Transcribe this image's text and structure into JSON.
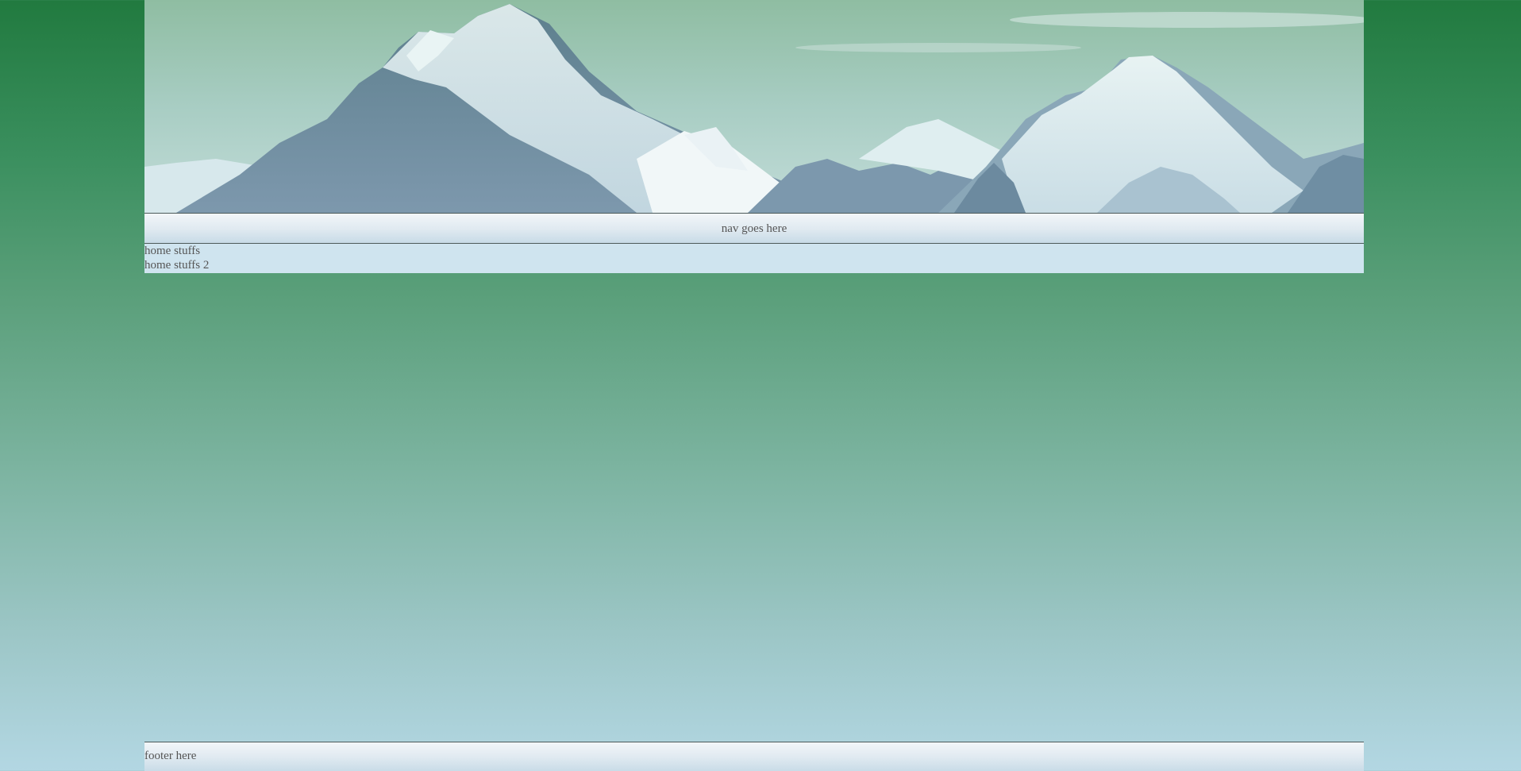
{
  "header": {
    "banner_image": "snowy-mountain-range"
  },
  "nav": {
    "label": "nav goes here"
  },
  "main": {
    "items": [
      {
        "label": "home stuffs"
      },
      {
        "label": "home stuffs 2"
      }
    ]
  },
  "footer": {
    "label": "footer here"
  },
  "colors": {
    "page_top": "#217a3f",
    "page_bottom": "#b3d7e3",
    "content_bg": "#cfe4ef",
    "text": "#555555"
  }
}
